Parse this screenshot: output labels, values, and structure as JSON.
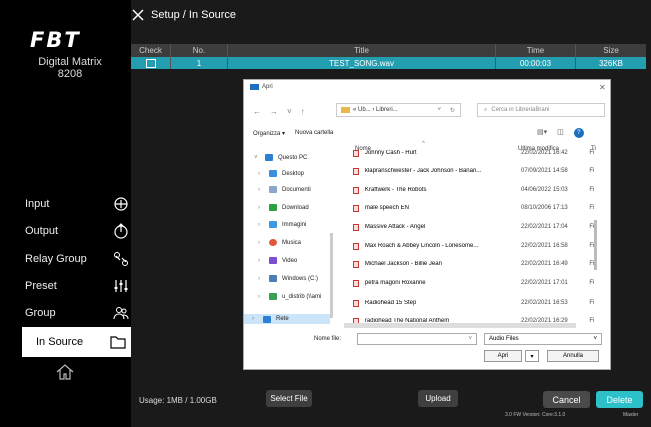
{
  "brand": {
    "logo": "FBT",
    "line1": "Digital Matrix",
    "line2": "8208"
  },
  "header": {
    "title": "Setup / In Source"
  },
  "nav": [
    {
      "label": "Input",
      "icon": "input-icon"
    },
    {
      "label": "Output",
      "icon": "output-icon"
    },
    {
      "label": "Relay Group",
      "icon": "link-icon"
    },
    {
      "label": "Preset",
      "icon": "sliders-icon"
    },
    {
      "label": "Group",
      "icon": "group-icon"
    },
    {
      "label": "In Source",
      "icon": "folder-icon"
    }
  ],
  "table": {
    "headers": [
      "Check",
      "No.",
      "Title",
      "Time",
      "Size"
    ],
    "rows": [
      {
        "no": "1",
        "title": "TEST_SONG.wav",
        "time": "00:00:03",
        "size": "326KB"
      }
    ]
  },
  "footer": {
    "usage": "Usage: 1MB / 1.00GB",
    "select_file": "Select File",
    "upload": "Upload",
    "cancel": "Cancel",
    "delete": "Delete",
    "fw": "3.0 FW Version: Core:3.1.0",
    "master": "Master"
  },
  "colors": {
    "accent": "#239db0",
    "delete": "#2cc1c8",
    "cancel": "#4a4a4a"
  },
  "dialog": {
    "title": "Apri",
    "address": "« Ub... › Libreri...",
    "search_placeholder": "Cerca in LibreriaBrani",
    "organize": "Organizza ▾",
    "new_folder": "Nuova cartella",
    "columns": {
      "name": "Nome",
      "date": "Ultima modifica",
      "type": "Ti"
    },
    "tree": [
      {
        "label": "Questo PC",
        "color": "#2d7fd3",
        "expanded": true
      },
      {
        "label": "Desktop",
        "color": "#3b8fe0"
      },
      {
        "label": "Documenti",
        "color": "#8aa7c9"
      },
      {
        "label": "Download",
        "color": "#2ea043"
      },
      {
        "label": "Immagini",
        "color": "#3c9ae0"
      },
      {
        "label": "Musica",
        "color": "#e0573b"
      },
      {
        "label": "Video",
        "color": "#7b4fd0"
      },
      {
        "label": "Windows (C:)",
        "color": "#4a7fb5"
      },
      {
        "label": "u_distrib (\\\\ami",
        "color": "#3aa055"
      },
      {
        "label": "Rete",
        "color": "#2d7fd3",
        "selected": true
      }
    ],
    "files": [
      {
        "name": "Johnny Cash - Hurt",
        "date": "22/02/2021 16:42",
        "type": "Fi"
      },
      {
        "name": "klapranschwester - Jack Johnson - Banan...",
        "date": "07/09/2021 14:58",
        "type": "Fi"
      },
      {
        "name": "Kraftwerk - The Robots",
        "date": "04/06/2022 15:03",
        "type": "Fi"
      },
      {
        "name": "male speech EN",
        "date": "08/10/2006 17:13",
        "type": "Fi"
      },
      {
        "name": "Massive Attack - Angel",
        "date": "22/02/2021 17:04",
        "type": "Fi"
      },
      {
        "name": "Max Roach & Abbey Lincoln - Lonesome...",
        "date": "22/02/2021 16:58",
        "type": "Fi"
      },
      {
        "name": "Michael Jackson - Billie Jean",
        "date": "22/02/2021 16:49",
        "type": "Fi"
      },
      {
        "name": "petra magoni Roxanne",
        "date": "22/02/2021 17:01",
        "type": "Fi"
      },
      {
        "name": "Radiohead 15 Step",
        "date": "22/02/2021 16:53",
        "type": "Fi"
      },
      {
        "name": "radiohead The National Anthem",
        "date": "22/02/2021 16:29",
        "type": "Fi"
      }
    ],
    "filename_label": "Nome file:",
    "filetype": "Audio Files",
    "open": "Apri",
    "cancel": "Annulla"
  }
}
